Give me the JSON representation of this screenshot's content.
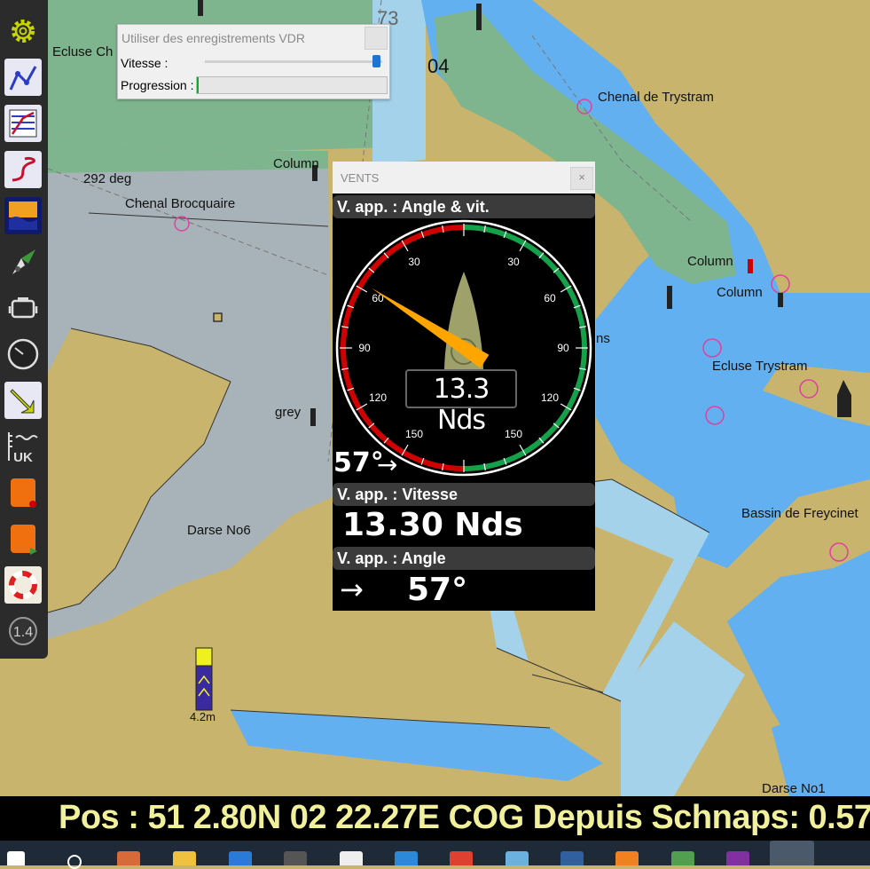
{
  "vdr_dialog": {
    "title": "Utiliser des enregistrements VDR",
    "speed_label": "Vitesse :",
    "progress_label": "Progression :",
    "speed_fraction": 0.97,
    "progress_fraction": 0.01
  },
  "wind_panel": {
    "title": "VENTS",
    "close_label": "×",
    "gauge_header": "V. app. : Angle & vit.",
    "gauge_center_value": "13.3 Nds",
    "gauge_angle_readout": "57°",
    "gauge_needle_angle_deg": -57,
    "gauge_ticks": [
      "30",
      "30",
      "60",
      "60",
      "90",
      "90",
      "120",
      "120",
      "150",
      "150"
    ],
    "speed_header": "V. app. : Vitesse",
    "speed_value": "13.30 Nds",
    "angle_header": "V. app. : Angle",
    "angle_arrow": "→",
    "angle_value": "57°"
  },
  "map": {
    "labels": {
      "ecluse_ch": "Ecluse Ch",
      "sounding_73": "73",
      "sounding_04": "04",
      "chenal_trystram": "Chenal de Trystram",
      "column_1": "Column",
      "bearing": "292 deg",
      "chenal_brocquaire": "Chenal Brocquaire",
      "column_2": "Column",
      "column_3": "Column",
      "ns": "ns",
      "ecluse_trystram": "Ecluse Trystram",
      "grey": "grey",
      "darse_no6": "Darse No6",
      "bassin_freycinet": "Bassin de Freycinet",
      "depth": "4.2m",
      "darse_no1": "Darse No1"
    }
  },
  "toolbar": {
    "icons": [
      "settings-icon",
      "route-icon",
      "route-manager-icon",
      "track-icon",
      "tide-icon",
      "ais-icon",
      "engine-dashboard-icon",
      "gauge-icon",
      "navigate-to-icon",
      "chart-units-icon",
      "record-icon",
      "play-icon",
      "lifering-icon",
      "scale-icon"
    ],
    "units_label": "UK",
    "scale_label": "1.4"
  },
  "status_bar": {
    "text": "Pos : 51 2.80N  02 22.27E  COG   Depuis Schnaps: 0.57"
  },
  "colors": {
    "land": "#c8b46c",
    "water_deep": "#63b0f0",
    "water_shallow": "#a4d2ea",
    "drying": "#7fb58e",
    "gauge_red": "#d10000",
    "gauge_green": "#14a14a",
    "needle": "#ffa500",
    "status_text": "#f1f09b"
  }
}
